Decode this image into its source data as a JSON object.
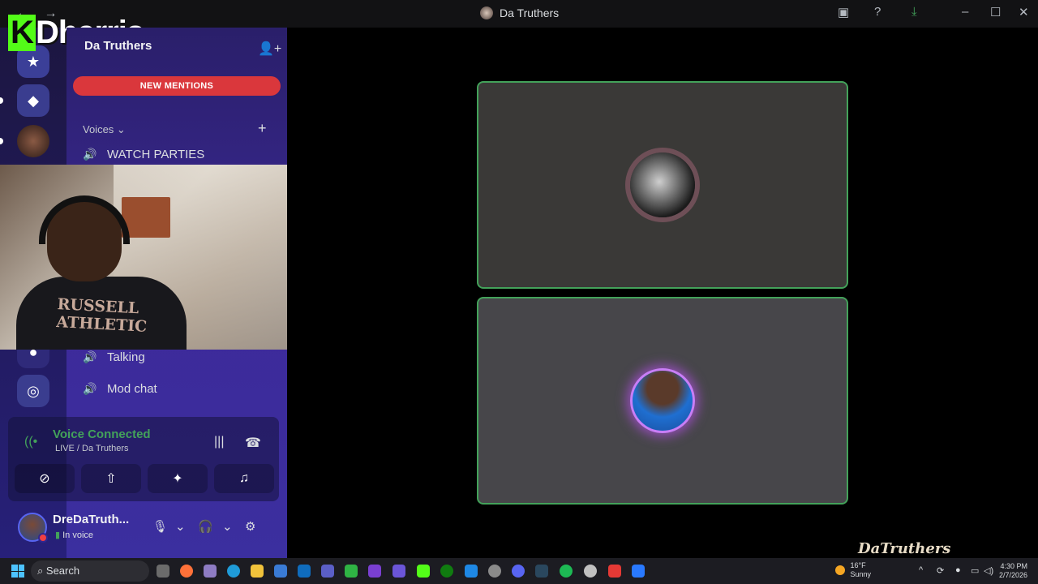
{
  "window": {
    "title": "Da Truthers"
  },
  "overlay": {
    "logo_text": "Dharris"
  },
  "sidebar": {
    "server_name": "Da Truthers",
    "new_mentions": "NEW MENTIONS",
    "category": "Voices",
    "channels": [
      {
        "label": "WATCH PARTIES"
      },
      {
        "label": "Talking"
      },
      {
        "label": "Mod chat"
      }
    ]
  },
  "webcam": {
    "shirt_text_line1": "RUSSELL",
    "shirt_text_line2": "ATHLETIC"
  },
  "voice_panel": {
    "title": "Voice Connected",
    "subtitle": "LIVE / Da Truthers"
  },
  "user_panel": {
    "username": "DreDaTruth...",
    "status": "In voice"
  },
  "watermark": {
    "text": "DaTruthers"
  },
  "taskbar": {
    "search_label": "Search",
    "weather_temp": "16°F",
    "weather_desc": "Sunny",
    "time": "4:30 PM",
    "date": "2/7/2026"
  },
  "colors": {
    "accent_green": "#43a25a",
    "mentions_red": "#da373c",
    "speaking_border": "#43a25a"
  }
}
